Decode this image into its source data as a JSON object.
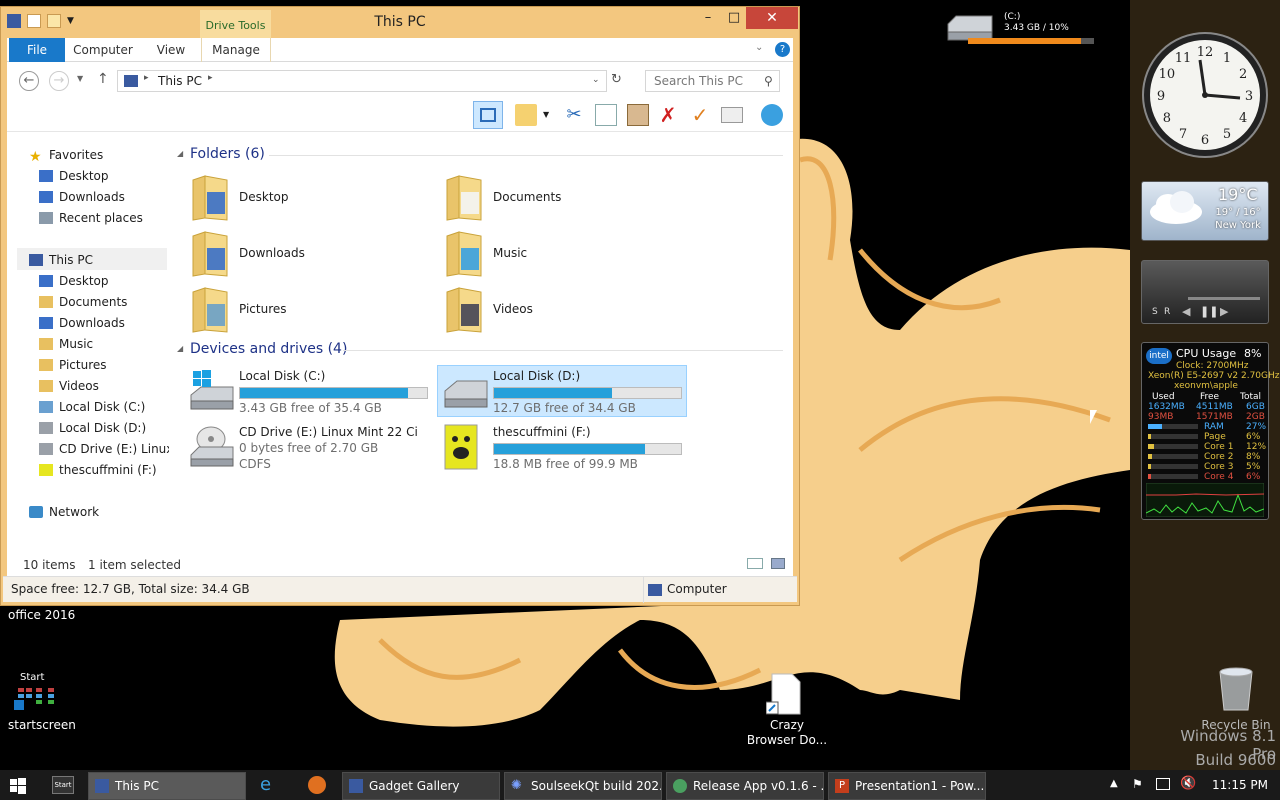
{
  "window": {
    "title": "This PC",
    "contextual_tab": "Drive Tools",
    "ribbon_tabs": [
      "File",
      "Computer",
      "View",
      "Manage"
    ],
    "address_path": "This PC",
    "search_placeholder": "Search This PC"
  },
  "nav": {
    "favorites_label": "Favorites",
    "favorites": [
      "Desktop",
      "Downloads",
      "Recent places"
    ],
    "this_pc_label": "This PC",
    "this_pc_items": [
      "Desktop",
      "Documents",
      "Downloads",
      "Music",
      "Pictures",
      "Videos",
      "Local Disk (C:)",
      "Local Disk (D:)",
      "CD Drive (E:) Linux M",
      "thescuffmini (F:)"
    ],
    "network_label": "Network"
  },
  "folders_group": "Folders (6)",
  "folders": [
    "Desktop",
    "Documents",
    "Downloads",
    "Music",
    "Pictures",
    "Videos"
  ],
  "drives_group": "Devices and drives (4)",
  "drives": [
    {
      "name": "Local Disk (C:)",
      "free": "3.43 GB free of 35.4 GB",
      "used_fraction": 0.9
    },
    {
      "name": "Local Disk (D:)",
      "free": "12.7 GB free of 34.4 GB",
      "used_fraction": 0.63
    },
    {
      "name": "CD Drive (E:) Linux Mint 22 Ci",
      "free": "0 bytes free of 2.70 GB",
      "fs": "CDFS"
    },
    {
      "name": "thescuffmini (F:)",
      "free": "18.8 MB free of 99.9 MB",
      "used_fraction": 0.81
    }
  ],
  "status": {
    "items": "10 items",
    "selected": "1 item selected",
    "space": "Space free: 12.7 GB, Total size: 34.4 GB",
    "location": "Computer"
  },
  "desktop": {
    "office_label": "office 2016",
    "start_label": "Start",
    "startscreen_label": "startscreen",
    "crazy_label_1": "Crazy",
    "crazy_label_2": "Browser Do...",
    "recycle_label": "Recycle Bin",
    "watermark_1": "Windows 8.1 Pro",
    "watermark_2": "Build 9600"
  },
  "gadgets": {
    "disk_label": "(C:)",
    "disk_value": "3.43 GB / 10%",
    "disk_used_fraction": 0.9,
    "clock_numbers": [
      "12",
      "1",
      "2",
      "3",
      "4",
      "5",
      "6",
      "7",
      "8",
      "9",
      "10",
      "11"
    ],
    "temp": "19°C",
    "range": "19° / 16°",
    "city": "New York",
    "media_s": "S",
    "media_r": "R",
    "cpu_title": "CPU Usage",
    "cpu_pct": "8%",
    "cpu_clock": "Clock: 2700MHz",
    "cpu_model": "Xeon(R) E5-2697 v2 2.70GHz",
    "cpu_host": "xeonvm\\apple",
    "mem_headers": [
      "Used",
      "Free",
      "Total"
    ],
    "mem_row1": [
      "1632MB",
      "4511MB",
      "6GB"
    ],
    "mem_row2": [
      "93MB",
      "1571MB",
      "2GB"
    ],
    "meters": [
      {
        "name": "RAM",
        "pct": "27%"
      },
      {
        "name": "Page",
        "pct": "6%"
      },
      {
        "name": "Core 1",
        "pct": "12%"
      },
      {
        "name": "Core 2",
        "pct": "8%"
      },
      {
        "name": "Core 3",
        "pct": "5%"
      },
      {
        "name": "Core 4",
        "pct": "6%"
      }
    ]
  },
  "taskbar": {
    "buttons": [
      "This PC",
      "Gadget Gallery",
      "SoulseekQt build 202...",
      "Release App v0.1.6 - ...",
      "Presentation1 - Pow..."
    ],
    "time": "11:15 PM"
  },
  "colors": {
    "accent": "#1979ca",
    "window_frame": "#f3c77f",
    "drive_bar": "#26a0da",
    "close": "#c7463a"
  }
}
